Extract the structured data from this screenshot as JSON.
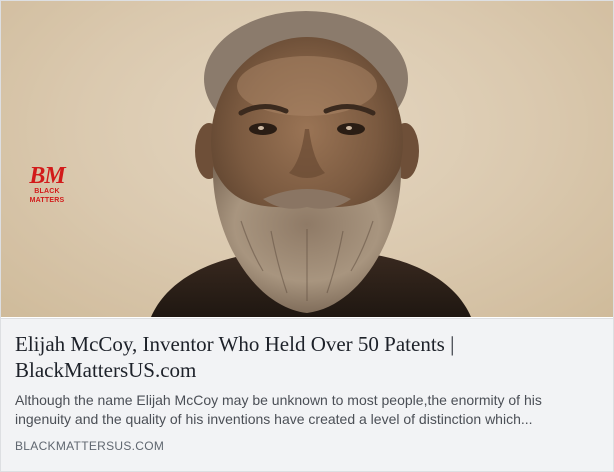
{
  "link_preview": {
    "image": {
      "subject": "sepia portrait photograph",
      "tint": "#d8c4a6"
    },
    "logo": {
      "mark": "BM",
      "text": "BLACK MATTERS",
      "color": "#d21a1a"
    },
    "title": "Elijah McCoy, Inventor Who Held Over 50 Patents |\nBlackMattersUS.com",
    "description": "Although the name Elijah McCoy may be unknown to most people,the enormity of his ingenuity and the quality of his inventions have created a level of distinction which...",
    "domain": "BLACKMATTERSUS.COM"
  }
}
